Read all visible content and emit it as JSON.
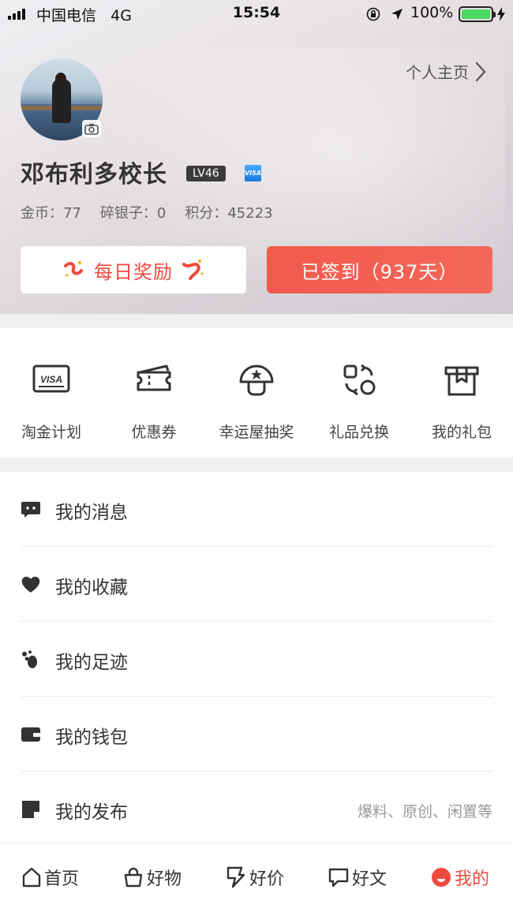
{
  "status_bar": {
    "carrier": "中国电信",
    "network": "4G",
    "time": "15:54",
    "battery": "100%"
  },
  "header": {
    "profile_link": "个人主页",
    "username": "邓布利多校长",
    "level": "LV46",
    "visa_badge": "VISA",
    "stats": {
      "coins": "金币：77",
      "silver": "碎银子：0",
      "points": "积分：45223"
    },
    "reward_button": "每日奖励",
    "signed_button": "已签到（937天）"
  },
  "quick_actions": [
    {
      "label": "淘金计划",
      "icon": "visa-card-icon"
    },
    {
      "label": "优惠券",
      "icon": "ticket-icon"
    },
    {
      "label": "幸运屋抽奖",
      "icon": "mushroom-icon"
    },
    {
      "label": "礼品兑换",
      "icon": "exchange-icon"
    },
    {
      "label": "我的礼包",
      "icon": "gift-box-icon"
    }
  ],
  "menu": [
    {
      "label": "我的消息",
      "icon": "message-icon",
      "hint": ""
    },
    {
      "label": "我的收藏",
      "icon": "heart-icon",
      "hint": ""
    },
    {
      "label": "我的足迹",
      "icon": "footprint-icon",
      "hint": ""
    },
    {
      "label": "我的钱包",
      "icon": "wallet-icon",
      "hint": ""
    },
    {
      "label": "我的发布",
      "icon": "post-icon",
      "hint": "爆料、原创、闲置等"
    }
  ],
  "tabbar": [
    {
      "label": "首页",
      "icon": "home-icon"
    },
    {
      "label": "好物",
      "icon": "bag-icon"
    },
    {
      "label": "好价",
      "icon": "bolt-tag-icon"
    },
    {
      "label": "好文",
      "icon": "comment-icon"
    },
    {
      "label": "我的",
      "icon": "me-icon",
      "active": true
    }
  ],
  "colors": {
    "accent": "#f04a3e",
    "signed_button": "#f25a4c",
    "level_badge": "#3b3b3b",
    "battery": "#4cd964"
  }
}
